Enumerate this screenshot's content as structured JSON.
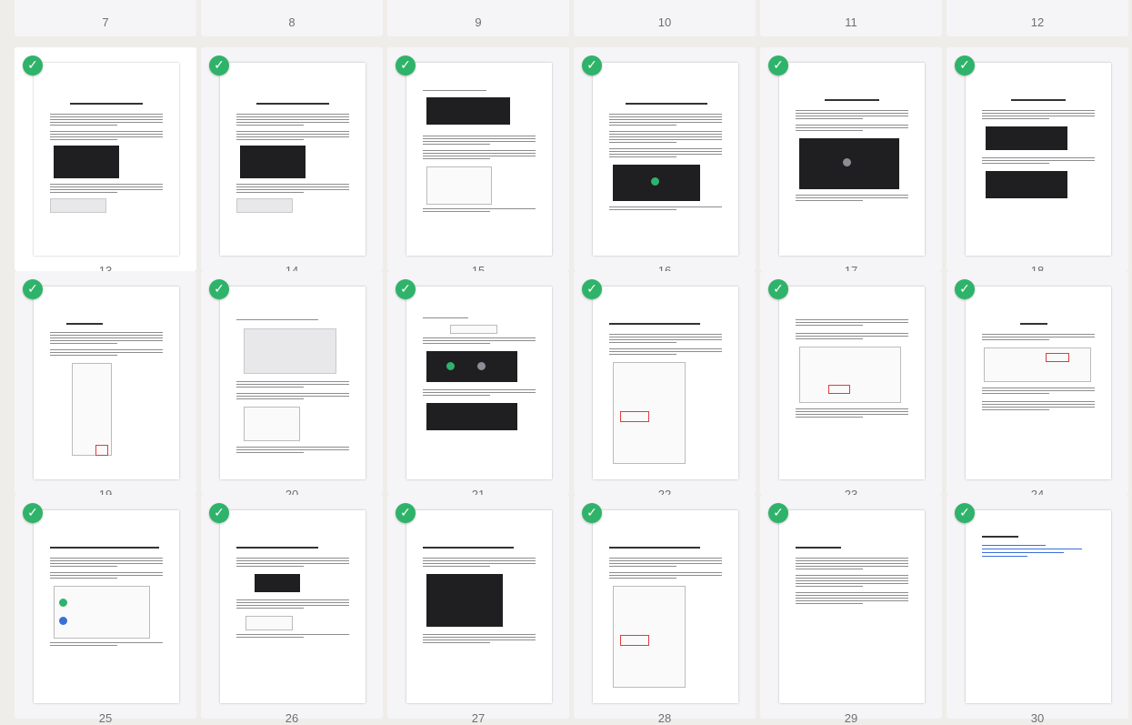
{
  "colors": {
    "check": "#2fb36a",
    "background": "#efedea",
    "card": "#f5f5f7"
  },
  "icons": {
    "check": "checkmark-icon"
  },
  "top_row": [
    {
      "number": "7"
    },
    {
      "number": "8"
    },
    {
      "number": "9"
    },
    {
      "number": "10"
    },
    {
      "number": "11"
    },
    {
      "number": "12"
    }
  ],
  "pages": [
    {
      "number": "13",
      "checked": true,
      "layout": "doc-image",
      "selected": true
    },
    {
      "number": "14",
      "checked": true,
      "layout": "doc-image"
    },
    {
      "number": "15",
      "checked": true,
      "layout": "dark-top"
    },
    {
      "number": "16",
      "checked": true,
      "layout": "text-dark"
    },
    {
      "number": "17",
      "checked": true,
      "layout": "dark-mid"
    },
    {
      "number": "18",
      "checked": true,
      "layout": "two-dark"
    },
    {
      "number": "19",
      "checked": true,
      "layout": "menu"
    },
    {
      "number": "20",
      "checked": true,
      "layout": "grid-ui"
    },
    {
      "number": "21",
      "checked": true,
      "layout": "three-dark"
    },
    {
      "number": "22",
      "checked": true,
      "layout": "menu-red"
    },
    {
      "number": "23",
      "checked": true,
      "layout": "light-ui"
    },
    {
      "number": "24",
      "checked": true,
      "layout": "ui-box"
    },
    {
      "number": "25",
      "checked": true,
      "layout": "list-ui"
    },
    {
      "number": "26",
      "checked": true,
      "layout": "small-dark"
    },
    {
      "number": "27",
      "checked": true,
      "layout": "dark-big"
    },
    {
      "number": "28",
      "checked": true,
      "layout": "menu-red"
    },
    {
      "number": "29",
      "checked": true,
      "layout": "text"
    },
    {
      "number": "30",
      "checked": true,
      "layout": "links"
    }
  ]
}
